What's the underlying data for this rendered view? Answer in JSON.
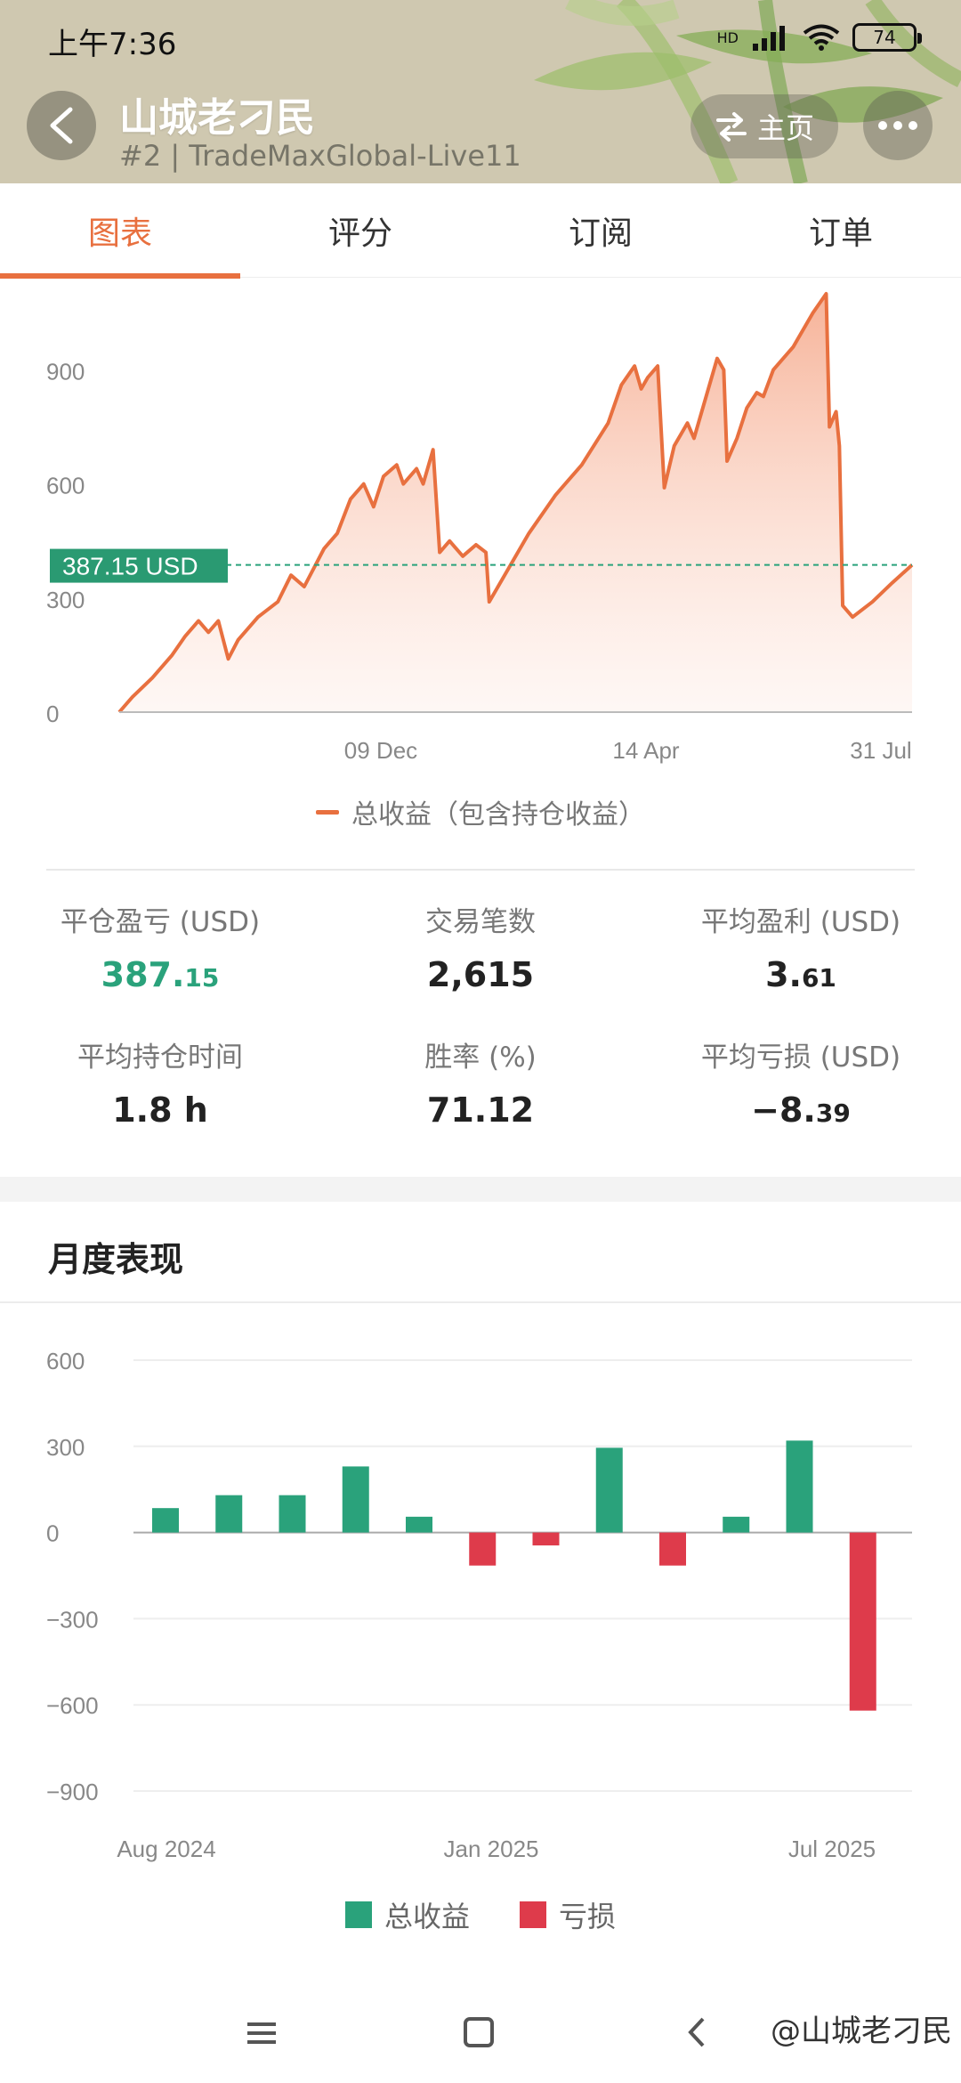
{
  "status_bar": {
    "time": "上午7:36",
    "battery": "74",
    "network": "HD"
  },
  "header": {
    "title": "山城老刁民",
    "subtitle": "#2 | TradeMaxGlobal-Live11",
    "home_label": "主页"
  },
  "tabs": [
    {
      "label": "图表",
      "active": true
    },
    {
      "label": "评分",
      "active": false
    },
    {
      "label": "订阅",
      "active": false
    },
    {
      "label": "订单",
      "active": false
    }
  ],
  "chart_data": [
    {
      "type": "area",
      "title": "",
      "legend": "总收益（包含持仓收益）",
      "y_ticks": [
        0,
        300,
        600,
        900
      ],
      "ylim": [
        0,
        1100
      ],
      "x_tick_labels": [
        "09 Dec",
        "14 Apr",
        "31 Jul"
      ],
      "current_value_label": "387.15 USD",
      "current_value": 387.15,
      "color": "#e8703f",
      "points": [
        [
          0,
          0
        ],
        [
          0.02,
          40
        ],
        [
          0.05,
          90
        ],
        [
          0.08,
          150
        ],
        [
          0.1,
          200
        ],
        [
          0.12,
          240
        ],
        [
          0.135,
          210
        ],
        [
          0.15,
          240
        ],
        [
          0.165,
          140
        ],
        [
          0.18,
          190
        ],
        [
          0.21,
          250
        ],
        [
          0.24,
          290
        ],
        [
          0.26,
          360
        ],
        [
          0.28,
          330
        ],
        [
          0.31,
          430
        ],
        [
          0.33,
          470
        ],
        [
          0.35,
          560
        ],
        [
          0.37,
          600
        ],
        [
          0.385,
          540
        ],
        [
          0.4,
          620
        ],
        [
          0.42,
          650
        ],
        [
          0.43,
          600
        ],
        [
          0.45,
          640
        ],
        [
          0.46,
          600
        ],
        [
          0.475,
          690
        ],
        [
          0.485,
          420
        ],
        [
          0.5,
          450
        ],
        [
          0.52,
          410
        ],
        [
          0.54,
          440
        ],
        [
          0.555,
          420
        ],
        [
          0.56,
          290
        ],
        [
          0.59,
          380
        ],
        [
          0.62,
          470
        ],
        [
          0.66,
          570
        ],
        [
          0.7,
          650
        ],
        [
          0.74,
          760
        ],
        [
          0.76,
          860
        ],
        [
          0.78,
          910
        ],
        [
          0.79,
          850
        ],
        [
          0.8,
          880
        ],
        [
          0.815,
          910
        ],
        [
          0.825,
          590
        ],
        [
          0.84,
          700
        ],
        [
          0.86,
          760
        ],
        [
          0.87,
          720
        ],
        [
          0.89,
          840
        ],
        [
          0.905,
          930
        ],
        [
          0.915,
          900
        ],
        [
          0.92,
          660
        ],
        [
          0.935,
          720
        ],
        [
          0.95,
          800
        ],
        [
          0.965,
          840
        ],
        [
          0.975,
          830
        ],
        [
          0.99,
          900
        ],
        [
          1.02,
          960
        ],
        [
          1.05,
          1050
        ],
        [
          1.07,
          1100
        ],
        [
          1.075,
          750
        ],
        [
          1.085,
          790
        ],
        [
          1.09,
          700
        ],
        [
          1.095,
          280
        ],
        [
          1.11,
          250
        ],
        [
          1.14,
          290
        ],
        [
          1.17,
          340
        ],
        [
          1.2,
          387
        ]
      ]
    },
    {
      "type": "bar",
      "title": "月度表现",
      "y_ticks": [
        600,
        300,
        0,
        -300,
        -600,
        -900
      ],
      "ylim": [
        -900,
        600
      ],
      "x_tick_labels": [
        "Aug 2024",
        "Jan 2025",
        "Jul 2025"
      ],
      "categories": [
        "Aug 2024",
        "Sep 2024",
        "Oct 2024",
        "Nov 2024",
        "Dec 2024",
        "Jan 2025",
        "Feb 2025",
        "Mar 2025",
        "Apr 2025",
        "May 2025",
        "Jun 2025",
        "Jul 2025"
      ],
      "values": [
        85,
        130,
        130,
        230,
        55,
        -115,
        -45,
        295,
        -115,
        55,
        320,
        -620
      ],
      "positive_color": "#2aa27b",
      "negative_color": "#de3b4b",
      "legend": [
        {
          "label": "总收益",
          "color": "#2aa27b"
        },
        {
          "label": "亏损",
          "color": "#de3b4b"
        }
      ]
    }
  ],
  "stats": [
    {
      "label": "平仓盈亏 (USD)",
      "main": "387.",
      "small": "15",
      "green": true
    },
    {
      "label": "交易笔数",
      "main": "2,615",
      "small": "",
      "green": false
    },
    {
      "label": "平均盈利 (USD)",
      "main": "3.",
      "small": "61",
      "green": false
    },
    {
      "label": "平均持仓时间",
      "main": "1.8 h",
      "small": "",
      "green": false
    },
    {
      "label": "胜率 (%)",
      "main": "71.12",
      "small": "",
      "green": false
    },
    {
      "label": "平均亏损 (USD)",
      "main": "−8.",
      "small": "39",
      "green": false
    }
  ],
  "monthly_title": "月度表现",
  "watermark": "@山城老刁民"
}
